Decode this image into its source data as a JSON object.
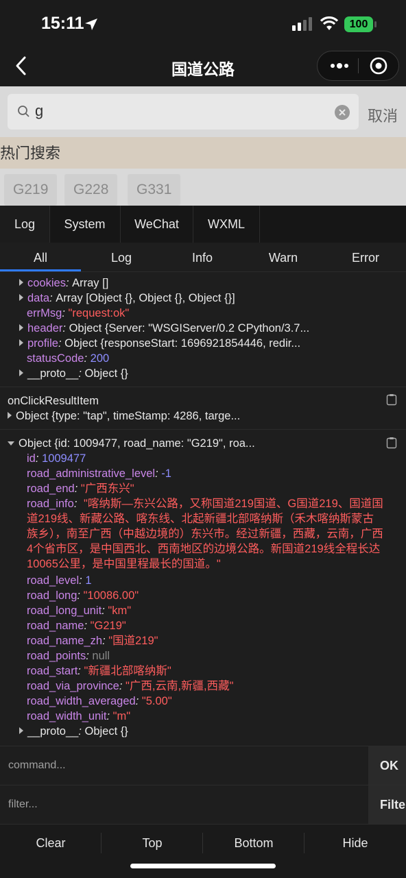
{
  "status": {
    "time": "15:11",
    "battery": "100"
  },
  "nav": {
    "title": "国道公路"
  },
  "search": {
    "value": "g",
    "cancel": "取消"
  },
  "hot": {
    "title": "热门搜索",
    "tags": [
      "G219",
      "G228",
      "G331"
    ]
  },
  "console": {
    "tabs": [
      "Log",
      "System",
      "WeChat",
      "WXML"
    ],
    "subtabs": [
      "All",
      "Log",
      "Info",
      "Warn",
      "Error"
    ],
    "response": {
      "cookies_key": "cookies",
      "cookies_val": "Array []",
      "data_key": "data",
      "data_val": "Array [Object {}, Object {}, Object {}]",
      "errMsg_key": "errMsg",
      "errMsg_val": "\"request:ok\"",
      "header_key": "header",
      "header_val": "Object {Server: \"WSGIServer/0.2 CPython/3.7...",
      "profile_key": "profile",
      "profile_val": "Object {responseStart: 1696921854446, redir...",
      "statusCode_key": "statusCode",
      "statusCode_val": "200",
      "proto_key": "__proto__",
      "proto_val": "Object {}"
    },
    "click_event": {
      "label": "onClickResultItem",
      "summary": "Object {type: \"tap\", timeStamp: 4286, targe..."
    },
    "record": {
      "summary": "Object {id: 1009477, road_name: \"G219\", roa...",
      "fields": [
        {
          "key": "id",
          "value": "1009477",
          "kind": "num"
        },
        {
          "key": "road_administrative_level",
          "value": "-1",
          "kind": "num"
        },
        {
          "key": "road_end",
          "value": "\"广西东兴\"",
          "kind": "str"
        }
      ],
      "road_info_key": "road_info",
      "road_info_value": "\"喀纳斯—东兴公路，又称国道219国道、G国道219、国道国道219线、新藏公路、喀东线、北起新疆北部喀纳斯（禾木喀纳斯蒙古族乡），南至广西（中越边境的）东兴市。经过新疆，西藏，云南，广西4个省市区，是中国西北、西南地区的边境公路。新国道219线全程长达10065公里，是中国里程最长的国道。\"",
      "fields2": [
        {
          "key": "road_level",
          "value": "1",
          "kind": "num"
        },
        {
          "key": "road_long",
          "value": "\"10086.00\"",
          "kind": "str"
        },
        {
          "key": "road_long_unit",
          "value": "\"km\"",
          "kind": "str"
        },
        {
          "key": "road_name",
          "value": "\"G219\"",
          "kind": "str"
        },
        {
          "key": "road_name_zh",
          "value": "\"国道219\"",
          "kind": "str"
        },
        {
          "key": "road_points",
          "value": "null",
          "kind": "nul"
        },
        {
          "key": "road_start",
          "value": "\"新疆北部喀纳斯\"",
          "kind": "str"
        },
        {
          "key": "road_via_province",
          "value": "\"广西,云南,新疆,西藏\"",
          "kind": "str"
        },
        {
          "key": "road_width_averaged",
          "value": "\"5.00\"",
          "kind": "str"
        },
        {
          "key": "road_width_unit",
          "value": "\"m\"",
          "kind": "str"
        }
      ],
      "proto_key": "__proto__",
      "proto_val": "Object {}"
    },
    "command_placeholder": "command...",
    "command_btn": "OK",
    "filter_placeholder": "filter...",
    "filter_btn": "Filter",
    "bottom": [
      "Clear",
      "Top",
      "Bottom",
      "Hide"
    ]
  }
}
